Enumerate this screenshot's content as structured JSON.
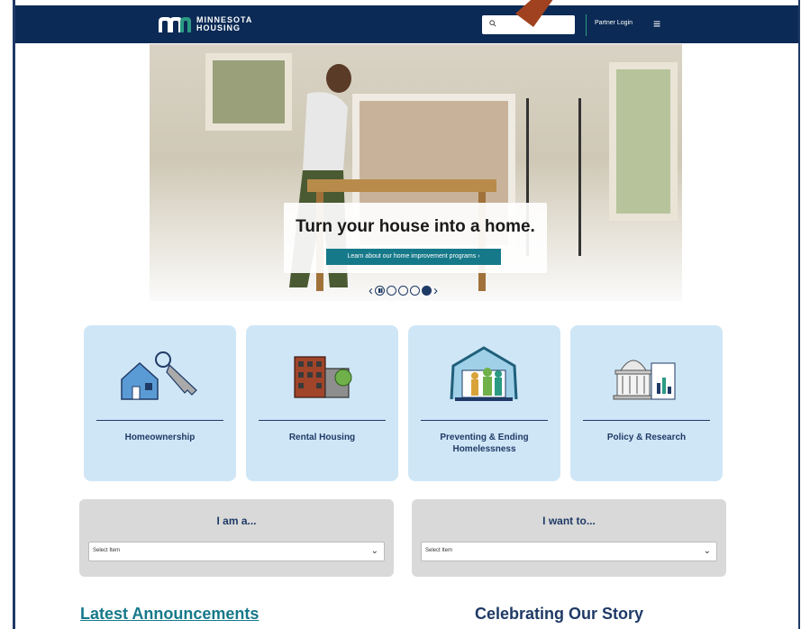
{
  "header": {
    "logo_text_line1": "MINNESOTA",
    "logo_text_line2": "HOUSING",
    "search_placeholder": "",
    "partner_login": "Partner Login",
    "colors": {
      "bar": "#0b2a55",
      "accent": "#2c9a83"
    }
  },
  "hero": {
    "title": "Turn your house into a home.",
    "button_label": "Learn about our home improvement programs",
    "carousel": {
      "total": 4,
      "active": 4
    }
  },
  "cards": [
    {
      "label": "Homeownership",
      "icon": "house-key-icon"
    },
    {
      "label": "Rental Housing",
      "icon": "apartment-building-icon"
    },
    {
      "label": "Preventing & Ending Homelessness",
      "icon": "family-shelter-icon"
    },
    {
      "label": "Policy & Research",
      "icon": "capitol-report-icon"
    }
  ],
  "selectors": [
    {
      "title": "I am a...",
      "value": "Select Item"
    },
    {
      "title": "I want to...",
      "value": "Select Item"
    }
  ],
  "sections": {
    "latest": "Latest Announcements",
    "story": "Celebrating Our Story"
  }
}
